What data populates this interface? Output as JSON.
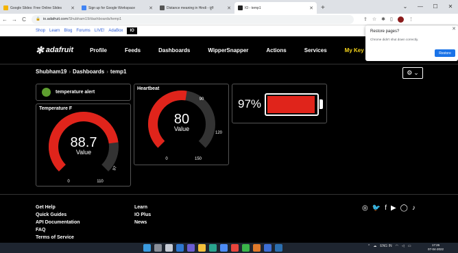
{
  "browser": {
    "tabs": [
      {
        "label": "Google Slides: Free Online Slides",
        "icon_color": "#f4b400"
      },
      {
        "label": "Sign up for Google Workspace",
        "icon_color": "#4285f4"
      },
      {
        "label": "Distance meaning in Hindi - दूरी",
        "icon_color": "#555555"
      },
      {
        "label": "IO - temp1",
        "icon_color": "#222222"
      }
    ],
    "new_tab": "+",
    "url_host": "io.adafruit.com",
    "url_path": "/Shubham19/dashboards/temp1"
  },
  "site": {
    "subnav": [
      "Shop",
      "Learn",
      "Blog",
      "Forums",
      "LIVE!",
      "AdaBox"
    ],
    "io_badge": "IO",
    "logo": "adafruit",
    "mainnav": [
      "Profile",
      "Feeds",
      "Dashboards",
      "WipperSnapper",
      "Actions",
      "Services"
    ],
    "my_key": "My Key"
  },
  "breadcrumb": {
    "user": "Shubham19",
    "section": "Dashboards",
    "page": "temp1"
  },
  "blocks": {
    "alert": {
      "label": "temperature alert",
      "color": "#5e9e2f"
    },
    "temp_gauge": {
      "title": "Temperature F",
      "value": "88.7",
      "unit": "Value",
      "min": "0",
      "max": "110",
      "mark": "97",
      "fill_fraction": 0.806
    },
    "heartbeat": {
      "title": "Heartbeat",
      "value": "80",
      "unit": "Value",
      "min": "0",
      "max": "150",
      "mark90": "90",
      "mark120": "120",
      "fill_fraction": 0.533
    },
    "battery": {
      "percent": "97%",
      "level": 0.97,
      "color": "#e0241b"
    }
  },
  "footer": {
    "col1": [
      "Get Help",
      "Quick Guides",
      "API Documentation",
      "FAQ",
      "Terms of Service"
    ],
    "col2": [
      "Learn",
      "IO Plus",
      "News"
    ]
  },
  "restore_popup": {
    "title": "Restore pages?",
    "message": "Chrome didn't shut down correctly.",
    "button": "Restore"
  },
  "taskbar": {
    "lang": "ENG",
    "region": "IN",
    "time": "17:26",
    "date": "07-04-2022"
  },
  "colors": {
    "accent_red": "#e0241b",
    "gauge_track": "#333333",
    "key_yellow": "#f6d51b"
  }
}
